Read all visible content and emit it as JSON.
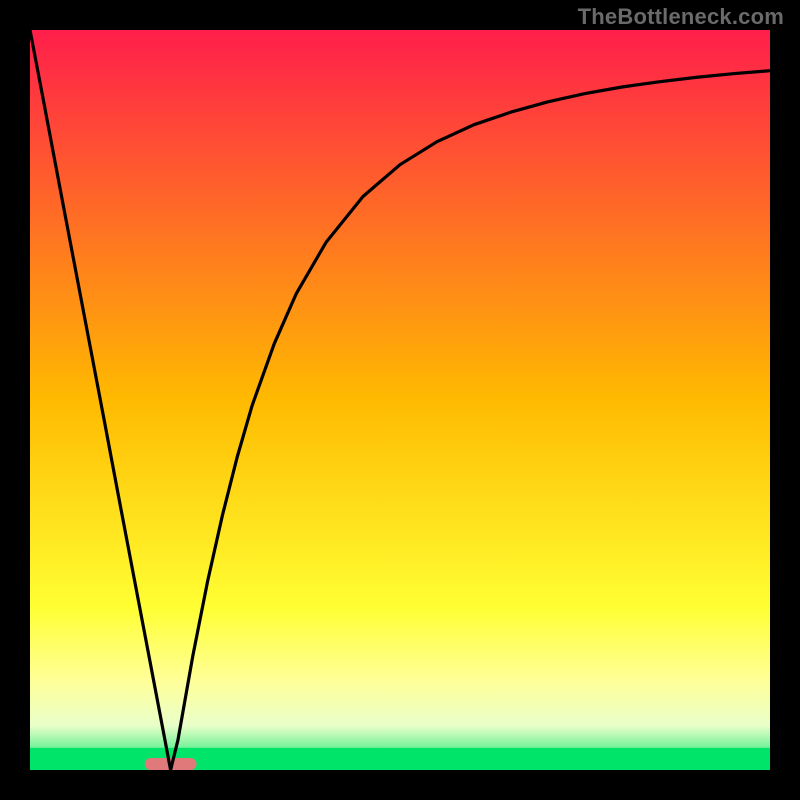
{
  "watermark": "TheBottleneck.com",
  "chart_data": {
    "type": "line",
    "title": "",
    "xlabel": "",
    "ylabel": "",
    "xlim": [
      0,
      1
    ],
    "ylim": [
      0,
      1
    ],
    "grid": false,
    "legend": false,
    "background_gradient": [
      {
        "pos": 0.0,
        "color": "#ff1e4b"
      },
      {
        "pos": 0.5,
        "color": "#ffba00"
      },
      {
        "pos": 0.78,
        "color": "#ffff33"
      },
      {
        "pos": 0.88,
        "color": "#ffff99"
      },
      {
        "pos": 0.94,
        "color": "#e9ffc9"
      },
      {
        "pos": 1.0,
        "color": "#00e46a"
      }
    ],
    "green_band": {
      "y_from": 0.0,
      "y_to": 0.03
    },
    "marker": {
      "x_center": 0.19,
      "y": 0.0,
      "width": 0.07,
      "color": "#e07a7a"
    },
    "series": [
      {
        "name": "curve",
        "x": [
          0.0,
          0.02,
          0.04,
          0.06,
          0.08,
          0.1,
          0.12,
          0.14,
          0.16,
          0.18,
          0.19,
          0.2,
          0.22,
          0.24,
          0.26,
          0.28,
          0.3,
          0.33,
          0.36,
          0.4,
          0.45,
          0.5,
          0.55,
          0.6,
          0.65,
          0.7,
          0.75,
          0.8,
          0.85,
          0.9,
          0.95,
          1.0
        ],
        "y": [
          1.0,
          0.895,
          0.789,
          0.684,
          0.579,
          0.474,
          0.368,
          0.263,
          0.158,
          0.053,
          0.0,
          0.041,
          0.154,
          0.255,
          0.344,
          0.423,
          0.492,
          0.576,
          0.644,
          0.713,
          0.775,
          0.818,
          0.849,
          0.872,
          0.889,
          0.903,
          0.914,
          0.923,
          0.93,
          0.936,
          0.941,
          0.945
        ]
      }
    ]
  }
}
